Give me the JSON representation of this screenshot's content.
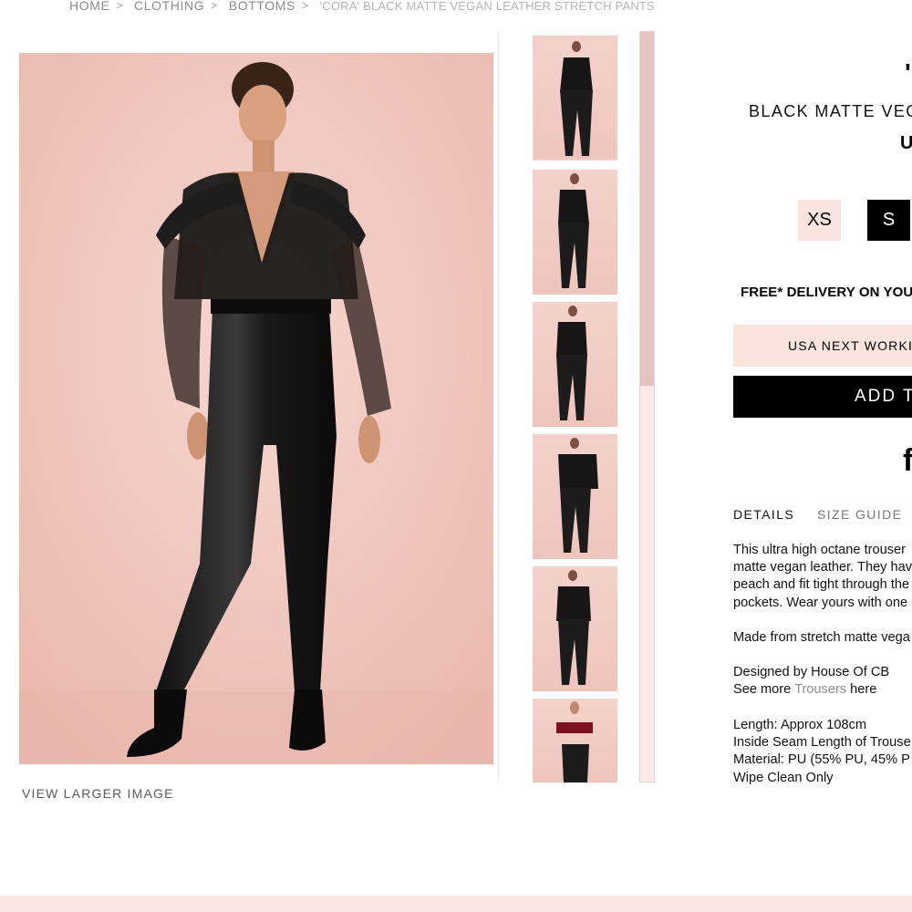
{
  "breadcrumb": {
    "items": [
      "HOME",
      "CLOTHING",
      "BOTTOMS"
    ],
    "current": "'CORA' BLACK MATTE VEGAN LEATHER STRETCH PANTS",
    "separator": ">"
  },
  "gallery": {
    "view_larger_label": "VIEW LARGER IMAGE"
  },
  "product": {
    "title_visible": "'",
    "subtitle_visible": "BLACK MATTE VEGA",
    "price_visible": "U",
    "sizes": [
      {
        "label": "XS",
        "selected": false
      },
      {
        "label": "S",
        "selected": true
      }
    ],
    "free_delivery_visible": "FREE* DELIVERY ON YOUR",
    "shipping_option_visible": "USA NEXT WORKI",
    "add_button_visible": "ADD T",
    "social_icon": "facebook-icon",
    "social_glyph": "f"
  },
  "tabs": {
    "details": "DETAILS",
    "size_guide": "SIZE GUIDE"
  },
  "description": {
    "para1_lines": [
      "This ultra high octane trouser",
      "matte vegan leather. They hav",
      "peach and fit tight through the",
      "pockets. Wear yours with one"
    ],
    "para2": "Made from stretch matte vega",
    "designed_by": "Designed by House Of CB",
    "see_more_prefix": "See more ",
    "see_more_link": "Trousers",
    "see_more_suffix": " here",
    "specs": [
      "Length: Approx 108cm",
      "Inside Seam Length of Trouse",
      "Material: PU (55% PU, 45% P",
      "Wipe Clean Only"
    ]
  },
  "colors": {
    "accent_pink": "#fbe3de",
    "black": "#000000",
    "link_grey": "#8d8d8d"
  }
}
